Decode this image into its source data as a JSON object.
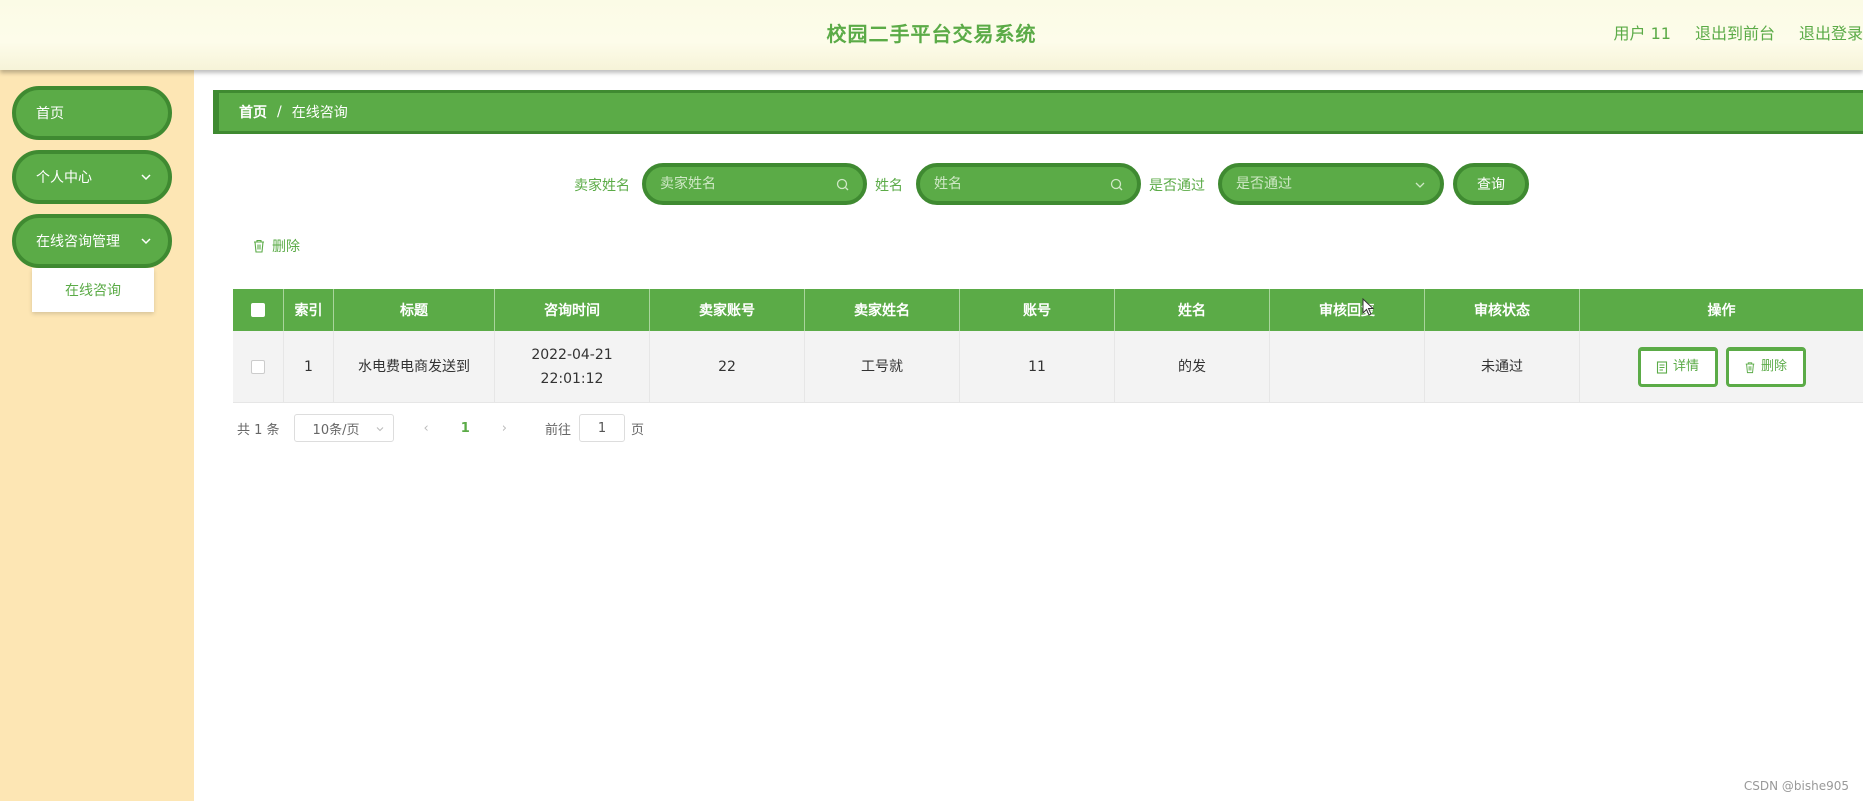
{
  "header": {
    "title": "校园二手平台交易系统",
    "user_label": "用户 11",
    "back_front": "退出到前台",
    "logout": "退出登录"
  },
  "sidebar": {
    "items": [
      {
        "label": "首页"
      },
      {
        "label": "个人中心"
      },
      {
        "label": "在线咨询管理"
      }
    ],
    "submenu": {
      "label": "在线咨询"
    }
  },
  "breadcrumb": {
    "home": "首页",
    "separator": "/",
    "current": "在线咨询"
  },
  "search": {
    "seller_name_label": "卖家姓名",
    "seller_name_placeholder": "卖家姓名",
    "name_label": "姓名",
    "name_placeholder": "姓名",
    "passed_label": "是否通过",
    "passed_placeholder": "是否通过",
    "query_button": "查询"
  },
  "toolbar": {
    "delete_label": "删除"
  },
  "table": {
    "headers": [
      "索引",
      "标题",
      "咨询时间",
      "卖家账号",
      "卖家姓名",
      "账号",
      "姓名",
      "审核回复",
      "审核状态",
      "操作"
    ],
    "rows": [
      {
        "index": "1",
        "title": "水电费电商发送到",
        "time": "2022-04-21 22:01:12",
        "seller_account": "22",
        "seller_name": "工号就",
        "account": "11",
        "name": "的发",
        "reply": "",
        "status": "未通过",
        "detail_label": "详情",
        "delete_label": "删除"
      }
    ]
  },
  "pager": {
    "total": "共 1 条",
    "page_size": "10条/页",
    "current_page": "1",
    "goto_label": "前往",
    "goto_value": "1",
    "page_suffix": "页"
  },
  "watermark": "CSDN @bishe905",
  "colors": {
    "accent": "#5bab47",
    "accent_dark": "#3f8a31",
    "sidebar_bg": "#fde6b4"
  }
}
